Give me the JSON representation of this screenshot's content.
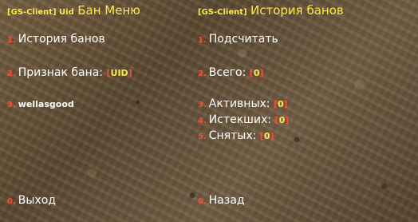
{
  "left_menu": {
    "title_prefix": "[GS-Client] Uid",
    "title": "Бан Меню",
    "items": [
      {
        "num": "1.",
        "label": "История банов"
      },
      {
        "num": "2.",
        "label": "Признак бана:",
        "bracket_open": "[",
        "value": "UID",
        "bracket_close": "]"
      },
      {
        "num": "3.",
        "label": "wellasgood"
      },
      {
        "num": "0.",
        "label": "Выход"
      }
    ]
  },
  "right_menu": {
    "title_prefix": "[GS-Client]",
    "title": "История банов",
    "items": [
      {
        "num": "1.",
        "label": "Подсчитать"
      },
      {
        "num": "2.",
        "label": "Всего:",
        "bracket_open": "[",
        "value": "0",
        "bracket_close": "]"
      },
      {
        "num": "3.",
        "label": "Активных:",
        "bracket_open": "[",
        "value": "0",
        "bracket_close": "]"
      },
      {
        "num": "4.",
        "label": "Истекших:",
        "bracket_open": "[",
        "value": "0",
        "bracket_close": "]"
      },
      {
        "num": "5.",
        "label": "Снятых:",
        "bracket_open": "[",
        "value": "0",
        "bracket_close": "]"
      },
      {
        "num": "0.",
        "label": "Назад"
      }
    ]
  },
  "colors": {
    "title": "#ffe94a",
    "item_number": "#ff4a38",
    "item_text": "#ffffff",
    "bracket": "#ff4a38",
    "value": "#ffe94a"
  }
}
